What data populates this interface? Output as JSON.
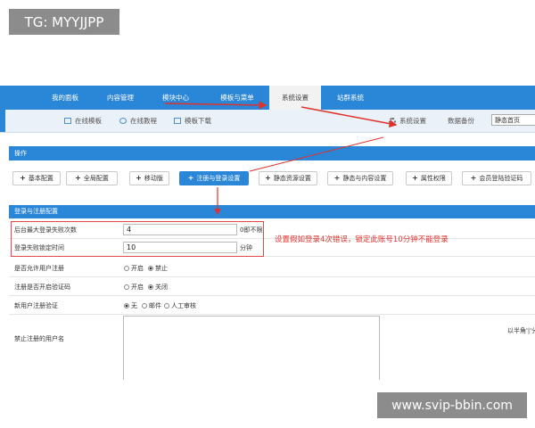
{
  "watermark_top": "TG: MYYJJPP",
  "watermark_bottom": "www.svip-bbin.com",
  "top_nav": [
    "我的面板",
    "内容管理",
    "模块中心",
    "模板与菜单",
    "系统设置",
    "站群系统"
  ],
  "sub_nav": {
    "online_templates": "在线模板",
    "online_tutorials": "在线教程",
    "template_download": "模板下载",
    "system_settings": "系统设置",
    "data_backup": "数据备份",
    "static_home": "静态首页"
  },
  "operations_bar": "操作",
  "buttons": [
    "基本配置",
    "全局配置",
    "移动版",
    "注册与登录设置",
    "静态资源设置",
    "静态与内容设置",
    "属性权限",
    "会员登陆验证码"
  ],
  "login_section_title": "登录与注册配置",
  "rows": {
    "max_fail_label": "后台最大登录失败次数",
    "max_fail_value": "4",
    "max_fail_unit": "0即不限",
    "lock_time_label": "登录失败锁定时间",
    "lock_time_value": "10",
    "lock_time_unit": "分钟",
    "allow_register_label": "是否允许用户注册",
    "allow_register_on": "开启",
    "allow_register_off": "禁止",
    "register_captcha_label": "注册是否开启验证码",
    "register_captcha_on": "开启",
    "register_captcha_off": "关闭",
    "new_user_verify_label": "新用户注册验证",
    "verify_none": "无",
    "verify_email": "邮件",
    "verify_manual": "人工审核",
    "forbid_names_label": "禁止注册的用户名",
    "side_note": "以半角'|'分"
  },
  "annotation": "设置假如登录4次错误，锁定此账号10分钟不能登录",
  "colors": {
    "primary_blue": "#2a86d6",
    "annotation_red": "#e0322c"
  }
}
